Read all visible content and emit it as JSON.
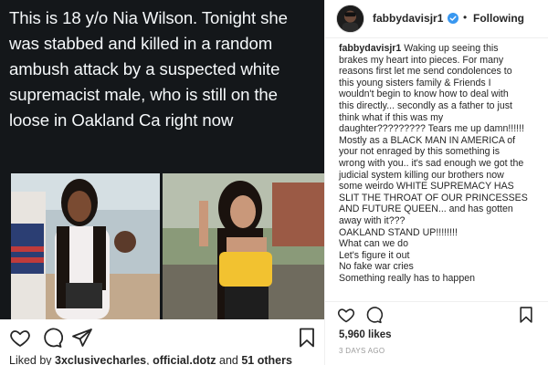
{
  "post": {
    "image_text": "This is 18 y/o Nia Wilson. Tonight she was stabbed and killed in a random ambush attack by a suspected white supremacist male, who is still on the loose in Oakland Ca right now",
    "liked_by_prefix": "Liked by ",
    "liked_by_user1": "3xclusivecharles",
    "liked_by_separator": ", ",
    "liked_by_user2": "official.dotz",
    "liked_by_suffix": " and ",
    "liked_by_others": "51 others"
  },
  "panel": {
    "username": "fabbydavisjr1",
    "separator": "•",
    "follow_label": "Following",
    "caption_lines": [
      "Waking up seeing this",
      "brakes my heart into pieces. For many",
      "reasons first let me send condolences to",
      "this young sisters family & Friends I",
      "wouldn't begin to know how to deal with",
      "this directly... secondly as a father to just",
      "think what if this was my",
      "daughter????????? Tears me up damn!!!!!!",
      "Mostly as a BLACK MAN IN AMERICA of",
      "your not enraged by this something is",
      "wrong with you.. it's sad enough we got the",
      "judicial system killing our brothers now",
      "some weirdo WHITE SUPREMACY HAS",
      "SLIT THE THROAT OF OUR PRINCESSES",
      "AND FUTURE QUEEN... and has gotten",
      "away with it???",
      "OAKLAND STAND UP!!!!!!!!",
      "What can we do",
      "Let's figure it out",
      "No fake war cries",
      "Something really has to happen"
    ],
    "likes": "5,960 likes",
    "timestamp": "3 DAYS AGO"
  },
  "icons": {
    "heart": "heart-icon",
    "comment": "comment-icon",
    "share": "share-icon",
    "bookmark": "bookmark-icon",
    "verified": "verified-badge-icon"
  },
  "colors": {
    "tweet_background": "#14171a",
    "tweet_text": "#f5f8fa",
    "verified_blue": "#3897f0",
    "secondary_text": "#999999"
  }
}
